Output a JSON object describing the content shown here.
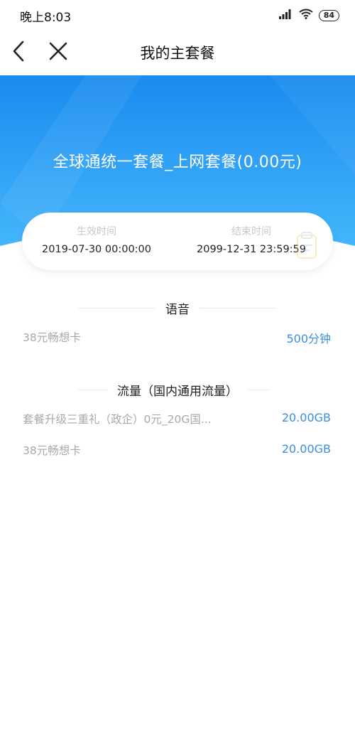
{
  "status_bar": {
    "time": "晚上8:03",
    "battery": "84"
  },
  "nav": {
    "title": "我的主套餐"
  },
  "plan": {
    "title": "全球通统一套餐_上网套餐(0.00元)"
  },
  "dates": {
    "start_label": "生效时间",
    "start_value": "2019-07-30 00:00:00",
    "end_label": "结束时间",
    "end_value": "2099-12-31 23:59:59"
  },
  "voice": {
    "header": "语音",
    "items": [
      {
        "name": "38元畅想卡",
        "amount": "500分钟"
      }
    ]
  },
  "data_section": {
    "header": "流量（国内通用流量）",
    "items": [
      {
        "name": "套餐升级三重礼（政企）0元_20G国...",
        "amount": "20.00GB"
      },
      {
        "name": "38元畅想卡",
        "amount": "20.00GB"
      }
    ]
  },
  "colors": {
    "hero_top": "#1e8ff0",
    "hero_bottom": "#3fb0fb",
    "amount": "#3a8fe0",
    "muted_text": "#a8a8a8"
  }
}
